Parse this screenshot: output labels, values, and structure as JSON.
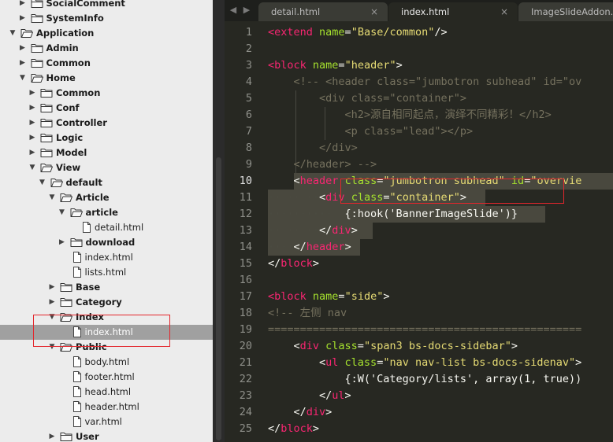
{
  "sidebar": {
    "rows": [
      {
        "label": "SocialComment",
        "type": "folder",
        "open": false,
        "depth": 1
      },
      {
        "label": "SystemInfo",
        "type": "folder",
        "open": false,
        "depth": 1
      },
      {
        "label": "Application",
        "type": "folder",
        "open": true,
        "depth": 0
      },
      {
        "label": "Admin",
        "type": "folder",
        "open": false,
        "depth": 1
      },
      {
        "label": "Common",
        "type": "folder",
        "open": false,
        "depth": 1
      },
      {
        "label": "Home",
        "type": "folder",
        "open": true,
        "depth": 1
      },
      {
        "label": "Common",
        "type": "folder",
        "open": false,
        "depth": 2
      },
      {
        "label": "Conf",
        "type": "folder",
        "open": false,
        "depth": 2
      },
      {
        "label": "Controller",
        "type": "folder",
        "open": false,
        "depth": 2
      },
      {
        "label": "Logic",
        "type": "folder",
        "open": false,
        "depth": 2
      },
      {
        "label": "Model",
        "type": "folder",
        "open": false,
        "depth": 2
      },
      {
        "label": "View",
        "type": "folder",
        "open": true,
        "depth": 2
      },
      {
        "label": "default",
        "type": "folder",
        "open": true,
        "depth": 3
      },
      {
        "label": "Article",
        "type": "folder",
        "open": true,
        "depth": 4
      },
      {
        "label": "article",
        "type": "folder",
        "open": true,
        "depth": 5
      },
      {
        "label": "detail.html",
        "type": "file",
        "depth": 6
      },
      {
        "label": "download",
        "type": "folder",
        "open": false,
        "depth": 5
      },
      {
        "label": "index.html",
        "type": "file",
        "depth": 5
      },
      {
        "label": "lists.html",
        "type": "file",
        "depth": 5
      },
      {
        "label": "Base",
        "type": "folder",
        "open": false,
        "depth": 4
      },
      {
        "label": "Category",
        "type": "folder",
        "open": false,
        "depth": 4
      },
      {
        "label": "Index",
        "type": "folder",
        "open": true,
        "depth": 4
      },
      {
        "label": "index.html",
        "type": "file",
        "depth": 5,
        "selected": true
      },
      {
        "label": "Public",
        "type": "folder",
        "open": true,
        "depth": 4
      },
      {
        "label": "body.html",
        "type": "file",
        "depth": 5
      },
      {
        "label": "footer.html",
        "type": "file",
        "depth": 5
      },
      {
        "label": "head.html",
        "type": "file",
        "depth": 5
      },
      {
        "label": "header.html",
        "type": "file",
        "depth": 5
      },
      {
        "label": "var.html",
        "type": "file",
        "depth": 5
      },
      {
        "label": "User",
        "type": "folder",
        "open": false,
        "depth": 4
      }
    ]
  },
  "tabs": [
    {
      "label": "detail.html",
      "active": false
    },
    {
      "label": "index.html",
      "active": true
    },
    {
      "label": "ImageSlideAddon.cla",
      "active": false
    }
  ],
  "tab_close_glyph": "×",
  "icons": {
    "nav_back": "◀",
    "nav_forward": "▶",
    "tri_open": "▼",
    "tri_closed": "▶"
  },
  "editor": {
    "current_line": 10,
    "lines": [
      [
        [
          "tg",
          "<extend "
        ],
        [
          "at",
          "name"
        ],
        [
          "",
          "="
        ],
        [
          "st",
          "\"Base/common\""
        ],
        [
          "",
          "/>"
        ]
      ],
      [],
      [
        [
          "tg",
          "<block "
        ],
        [
          "at",
          "name"
        ],
        [
          "",
          "="
        ],
        [
          "st",
          "\"header\""
        ],
        [
          "",
          ">"
        ]
      ],
      [
        [
          "",
          "    "
        ],
        [
          "cm",
          "<!-- <header class=\"jumbotron subhead\" id=\"ov"
        ]
      ],
      [
        [
          "",
          "        "
        ],
        [
          "cm",
          "<div class=\"container\">"
        ]
      ],
      [
        [
          "",
          "            "
        ],
        [
          "cm",
          "<h2>源自相同起点，演绎不同精彩！</h2>"
        ]
      ],
      [
        [
          "",
          "            "
        ],
        [
          "cm",
          "<p class=\"lead\"></p>"
        ]
      ],
      [
        [
          "",
          "        "
        ],
        [
          "cm",
          "</div>"
        ]
      ],
      [
        [
          "",
          "    "
        ],
        [
          "cm",
          "</header> -->"
        ]
      ],
      [
        [
          "",
          "    "
        ],
        [
          "",
          "<"
        ],
        [
          "tg",
          "header "
        ],
        [
          "at",
          "class"
        ],
        [
          "",
          "="
        ],
        [
          "st",
          "\"jumbotron subhead\""
        ],
        [
          "",
          " "
        ],
        [
          "at",
          "id"
        ],
        [
          "",
          "="
        ],
        [
          "st",
          "\"overvie"
        ]
      ],
      [
        [
          "ws",
          "········"
        ],
        [
          "",
          "<"
        ],
        [
          "tg",
          "div "
        ],
        [
          "at",
          "class"
        ],
        [
          "",
          "="
        ],
        [
          "st",
          "\"container\""
        ],
        [
          "",
          ">"
        ]
      ],
      [
        [
          "ws",
          "··········"
        ],
        [
          "",
          "  {:hook('BannerImageSlide')}"
        ]
      ],
      [
        [
          "ws",
          "········"
        ],
        [
          "",
          "</"
        ],
        [
          "tg",
          "div"
        ],
        [
          "",
          ">"
        ]
      ],
      [
        [
          "ws",
          "····"
        ],
        [
          "",
          "</"
        ],
        [
          "tg",
          "header"
        ],
        [
          "",
          ">"
        ]
      ],
      [
        [
          "",
          "</"
        ],
        [
          "tg",
          "block"
        ],
        [
          "",
          ">"
        ]
      ],
      [],
      [
        [
          "tg",
          "<block "
        ],
        [
          "at",
          "name"
        ],
        [
          "",
          "="
        ],
        [
          "st",
          "\"side\""
        ],
        [
          "",
          ">"
        ]
      ],
      [
        [
          "cm",
          "<!-- 左侧 nav"
        ]
      ],
      [
        [
          "cm",
          "================================================="
        ]
      ],
      [
        [
          "",
          "    <"
        ],
        [
          "tg",
          "div "
        ],
        [
          "at",
          "class"
        ],
        [
          "",
          "="
        ],
        [
          "st",
          "\"span3 bs-docs-sidebar\""
        ],
        [
          "",
          ">"
        ]
      ],
      [
        [
          "",
          "        <"
        ],
        [
          "tg",
          "ul "
        ],
        [
          "at",
          "class"
        ],
        [
          "",
          "="
        ],
        [
          "st",
          "\"nav nav-list bs-docs-sidenav\""
        ],
        [
          "",
          ">"
        ]
      ],
      [
        [
          "",
          "            {:W('Category/lists', array(1, true))"
        ]
      ],
      [
        [
          "",
          "        </"
        ],
        [
          "tg",
          "ul"
        ],
        [
          "",
          ">"
        ]
      ],
      [
        [
          "",
          "    </"
        ],
        [
          "tg",
          "div"
        ],
        [
          "",
          ">"
        ]
      ],
      [
        [
          "",
          "</"
        ],
        [
          "tg",
          "block"
        ],
        [
          "",
          ">"
        ]
      ]
    ]
  },
  "colors": {
    "annotation": "#e3262c",
    "tag": "#f92672",
    "attr": "#a6e22e",
    "string": "#e6db74",
    "comment": "#75715e"
  }
}
